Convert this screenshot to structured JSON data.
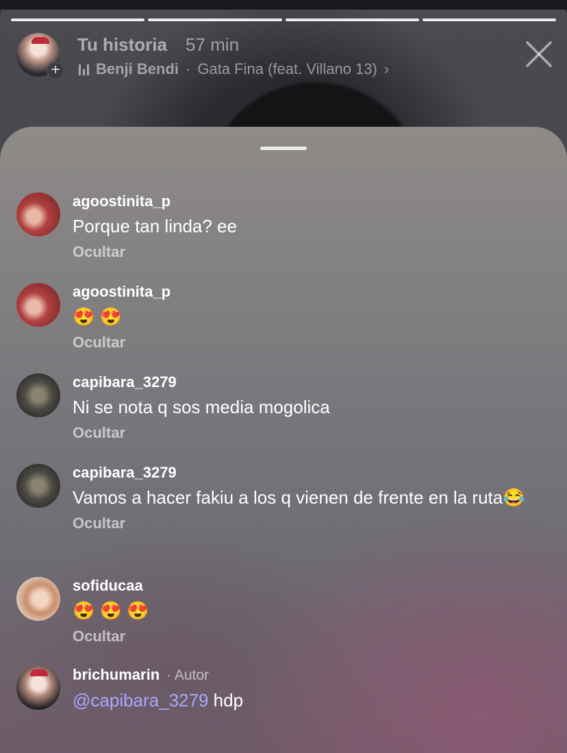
{
  "story": {
    "title": "Tu historia",
    "time": "57 min",
    "music_artist": "Benji Bendi",
    "music_separator": "·",
    "music_song": "Gata Fina (feat. Villano 13)",
    "music_chevron": "›",
    "progress_segments": 4,
    "progress_done": 4,
    "add_icon": "plus-icon",
    "close_icon": "close-icon"
  },
  "comments": [
    {
      "username": "agoostinita_p",
      "text": "Porque tan linda? ee",
      "hide_label": "Ocultar"
    },
    {
      "username": "agoostinita_p",
      "text": "😍 😍",
      "hide_label": "Ocultar"
    },
    {
      "username": "capibara_3279",
      "text": "Ni se nota q sos media mogolica",
      "hide_label": "Ocultar"
    },
    {
      "username": "capibara_3279",
      "text": "Vamos a hacer fakiu a los q vienen de frente en la ruta😂",
      "hide_label": "Ocultar"
    },
    {
      "username": "sofiducaa",
      "text": "😍 😍 😍",
      "hide_label": "Ocultar"
    },
    {
      "username": "brichumarin",
      "author_label": "· Autor",
      "mention": "@capibara_3279",
      "text": " hdp"
    }
  ]
}
